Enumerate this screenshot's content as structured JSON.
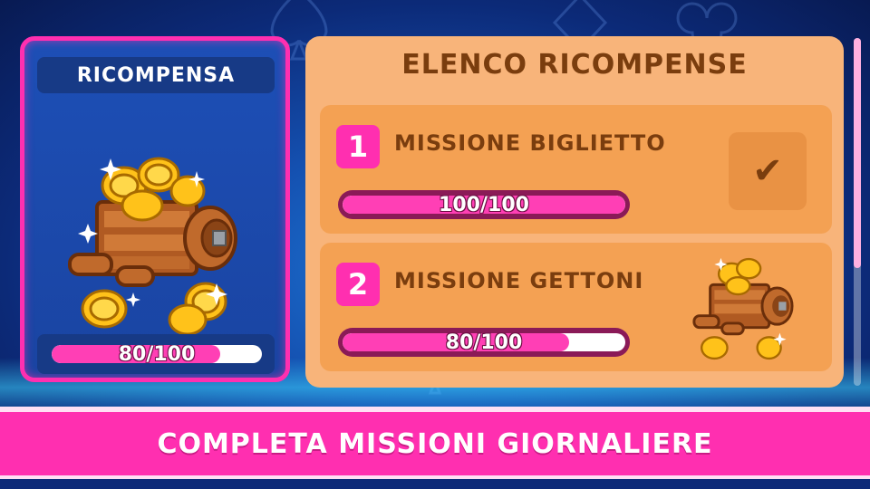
{
  "reward_panel": {
    "title": "RICOMPENSA",
    "progress_text": "80/100",
    "progress_fraction": 0.8
  },
  "reward_list": {
    "title": "ELENCO RICOMPENSE",
    "missions": [
      {
        "number": "1",
        "name": "MISSIONE BIGLIETTO",
        "progress_text": "100/100",
        "progress_fraction": 1.0,
        "status_icon": "checkmark-icon",
        "status_glyph": "✔"
      },
      {
        "number": "2",
        "name": "MISSIONE GETTONI",
        "progress_text": "80/100",
        "progress_fraction": 0.8,
        "reward_icon": "coin-cart-icon"
      }
    ]
  },
  "banner": {
    "text": "COMPLETA MISSIONI GIORNALIERE"
  },
  "colors": {
    "accent_pink": "#ff2fb0",
    "panel_orange": "#f8b47a",
    "mission_orange": "#f4a153",
    "title_brown": "#7a3d0e",
    "background_blue": "#1450b0"
  }
}
